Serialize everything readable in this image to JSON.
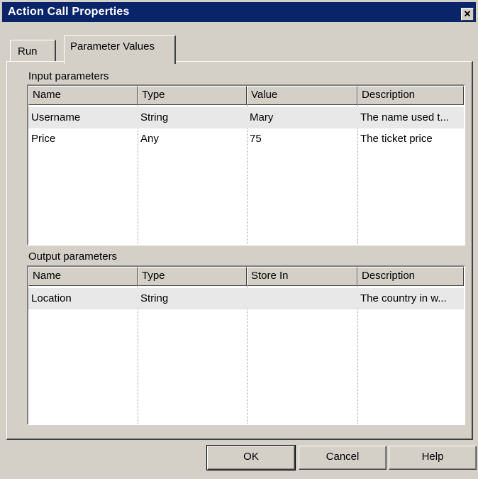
{
  "window": {
    "title": "Action Call Properties",
    "close_glyph": "✕"
  },
  "tabs": [
    {
      "label": "Run",
      "active": false
    },
    {
      "label": "Parameter Values",
      "active": true
    }
  ],
  "input_parameters": {
    "label": "Input parameters",
    "columns": [
      "Name",
      "Type",
      "Value",
      "Description"
    ],
    "rows": [
      [
        "Username",
        "String",
        "Mary",
        "The name used t..."
      ],
      [
        "Price",
        "Any",
        "75",
        "The ticket price"
      ]
    ]
  },
  "output_parameters": {
    "label": "Output parameters",
    "columns": [
      "Name",
      "Type",
      "Store In",
      "Description"
    ],
    "rows": [
      [
        "Location",
        "String",
        "",
        "The country in w..."
      ]
    ]
  },
  "buttons": {
    "ok": "OK",
    "cancel": "Cancel",
    "help": "Help"
  }
}
